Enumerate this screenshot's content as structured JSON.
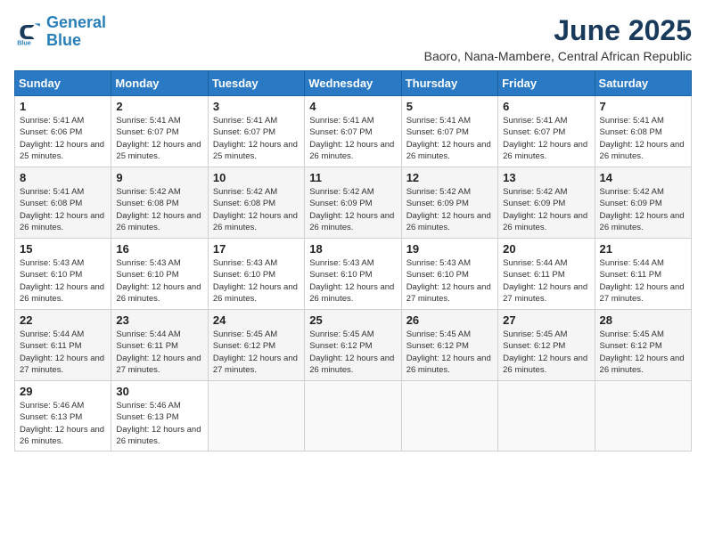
{
  "logo": {
    "line1": "General",
    "line2": "Blue"
  },
  "title": "June 2025",
  "location": "Baoro, Nana-Mambere, Central African Republic",
  "headers": [
    "Sunday",
    "Monday",
    "Tuesday",
    "Wednesday",
    "Thursday",
    "Friday",
    "Saturday"
  ],
  "weeks": [
    [
      {
        "day": "1",
        "sunrise": "5:41 AM",
        "sunset": "6:06 PM",
        "daylight": "12 hours and 25 minutes."
      },
      {
        "day": "2",
        "sunrise": "5:41 AM",
        "sunset": "6:07 PM",
        "daylight": "12 hours and 25 minutes."
      },
      {
        "day": "3",
        "sunrise": "5:41 AM",
        "sunset": "6:07 PM",
        "daylight": "12 hours and 25 minutes."
      },
      {
        "day": "4",
        "sunrise": "5:41 AM",
        "sunset": "6:07 PM",
        "daylight": "12 hours and 26 minutes."
      },
      {
        "day": "5",
        "sunrise": "5:41 AM",
        "sunset": "6:07 PM",
        "daylight": "12 hours and 26 minutes."
      },
      {
        "day": "6",
        "sunrise": "5:41 AM",
        "sunset": "6:07 PM",
        "daylight": "12 hours and 26 minutes."
      },
      {
        "day": "7",
        "sunrise": "5:41 AM",
        "sunset": "6:08 PM",
        "daylight": "12 hours and 26 minutes."
      }
    ],
    [
      {
        "day": "8",
        "sunrise": "5:41 AM",
        "sunset": "6:08 PM",
        "daylight": "12 hours and 26 minutes."
      },
      {
        "day": "9",
        "sunrise": "5:42 AM",
        "sunset": "6:08 PM",
        "daylight": "12 hours and 26 minutes."
      },
      {
        "day": "10",
        "sunrise": "5:42 AM",
        "sunset": "6:08 PM",
        "daylight": "12 hours and 26 minutes."
      },
      {
        "day": "11",
        "sunrise": "5:42 AM",
        "sunset": "6:09 PM",
        "daylight": "12 hours and 26 minutes."
      },
      {
        "day": "12",
        "sunrise": "5:42 AM",
        "sunset": "6:09 PM",
        "daylight": "12 hours and 26 minutes."
      },
      {
        "day": "13",
        "sunrise": "5:42 AM",
        "sunset": "6:09 PM",
        "daylight": "12 hours and 26 minutes."
      },
      {
        "day": "14",
        "sunrise": "5:42 AM",
        "sunset": "6:09 PM",
        "daylight": "12 hours and 26 minutes."
      }
    ],
    [
      {
        "day": "15",
        "sunrise": "5:43 AM",
        "sunset": "6:10 PM",
        "daylight": "12 hours and 26 minutes."
      },
      {
        "day": "16",
        "sunrise": "5:43 AM",
        "sunset": "6:10 PM",
        "daylight": "12 hours and 26 minutes."
      },
      {
        "day": "17",
        "sunrise": "5:43 AM",
        "sunset": "6:10 PM",
        "daylight": "12 hours and 26 minutes."
      },
      {
        "day": "18",
        "sunrise": "5:43 AM",
        "sunset": "6:10 PM",
        "daylight": "12 hours and 26 minutes."
      },
      {
        "day": "19",
        "sunrise": "5:43 AM",
        "sunset": "6:10 PM",
        "daylight": "12 hours and 27 minutes."
      },
      {
        "day": "20",
        "sunrise": "5:44 AM",
        "sunset": "6:11 PM",
        "daylight": "12 hours and 27 minutes."
      },
      {
        "day": "21",
        "sunrise": "5:44 AM",
        "sunset": "6:11 PM",
        "daylight": "12 hours and 27 minutes."
      }
    ],
    [
      {
        "day": "22",
        "sunrise": "5:44 AM",
        "sunset": "6:11 PM",
        "daylight": "12 hours and 27 minutes."
      },
      {
        "day": "23",
        "sunrise": "5:44 AM",
        "sunset": "6:11 PM",
        "daylight": "12 hours and 27 minutes."
      },
      {
        "day": "24",
        "sunrise": "5:45 AM",
        "sunset": "6:12 PM",
        "daylight": "12 hours and 27 minutes."
      },
      {
        "day": "25",
        "sunrise": "5:45 AM",
        "sunset": "6:12 PM",
        "daylight": "12 hours and 26 minutes."
      },
      {
        "day": "26",
        "sunrise": "5:45 AM",
        "sunset": "6:12 PM",
        "daylight": "12 hours and 26 minutes."
      },
      {
        "day": "27",
        "sunrise": "5:45 AM",
        "sunset": "6:12 PM",
        "daylight": "12 hours and 26 minutes."
      },
      {
        "day": "28",
        "sunrise": "5:45 AM",
        "sunset": "6:12 PM",
        "daylight": "12 hours and 26 minutes."
      }
    ],
    [
      {
        "day": "29",
        "sunrise": "5:46 AM",
        "sunset": "6:13 PM",
        "daylight": "12 hours and 26 minutes."
      },
      {
        "day": "30",
        "sunrise": "5:46 AM",
        "sunset": "6:13 PM",
        "daylight": "12 hours and 26 minutes."
      },
      null,
      null,
      null,
      null,
      null
    ]
  ]
}
